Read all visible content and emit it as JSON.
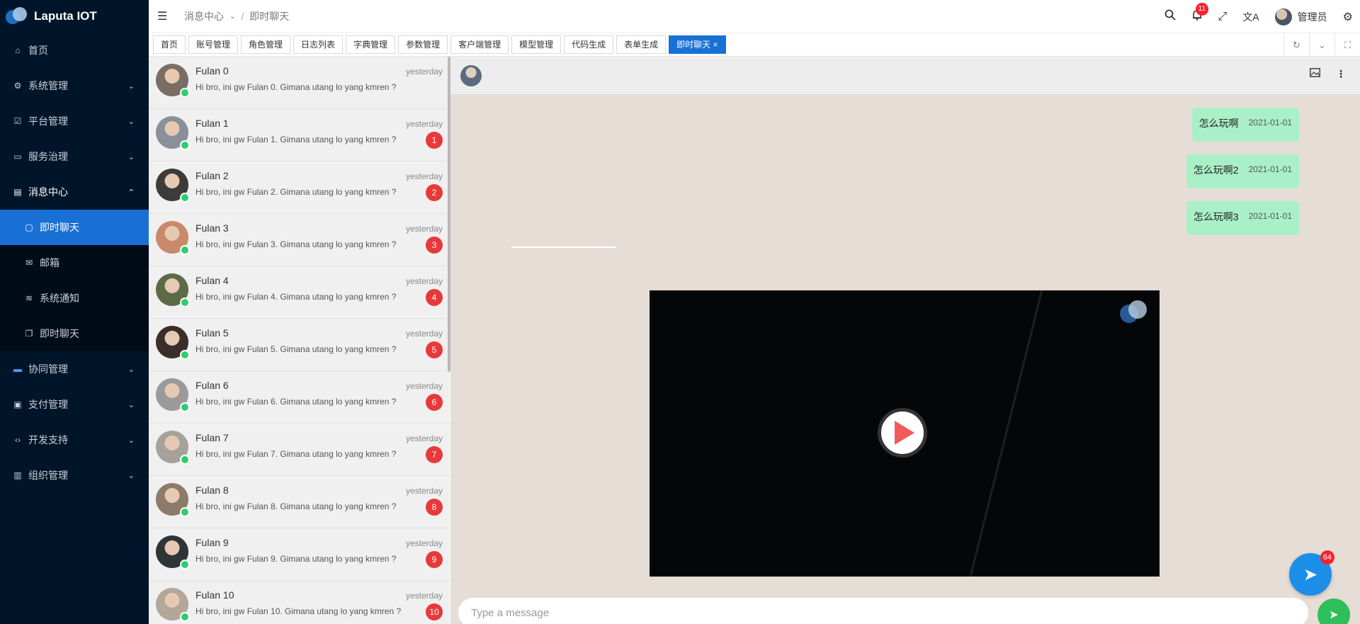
{
  "app": {
    "title": "Laputa IOT"
  },
  "sidebar": {
    "items": [
      {
        "label": "首页",
        "icon": "home-icon"
      },
      {
        "label": "系统管理",
        "icon": "gear-icon"
      },
      {
        "label": "平台管理",
        "icon": "check-square-icon"
      },
      {
        "label": "服务治理",
        "icon": "monitor-icon"
      },
      {
        "label": "消息中心",
        "icon": "message-icon"
      },
      {
        "label": "协同管理",
        "icon": "card-icon"
      },
      {
        "label": "支付管理",
        "icon": "payment-icon"
      },
      {
        "label": "开发支持",
        "icon": "code-icon"
      },
      {
        "label": "组织管理",
        "icon": "building-icon"
      }
    ],
    "submenu": [
      {
        "label": "即时聊天",
        "icon": "chat-icon"
      },
      {
        "label": "邮箱",
        "icon": "mail-icon"
      },
      {
        "label": "系统通知",
        "icon": "notification-icon"
      },
      {
        "label": "即时聊天",
        "icon": "chat-copy-icon"
      }
    ]
  },
  "header": {
    "breadcrumb": [
      "消息中心",
      "即时聊天"
    ],
    "notification_count": "11",
    "user_name": "管理员"
  },
  "tabs": [
    {
      "label": "首页"
    },
    {
      "label": "账号管理"
    },
    {
      "label": "角色管理"
    },
    {
      "label": "日志列表"
    },
    {
      "label": "字典管理"
    },
    {
      "label": "参数管理"
    },
    {
      "label": "客户端管理"
    },
    {
      "label": "模型管理"
    },
    {
      "label": "代码生成"
    },
    {
      "label": "表单生成"
    },
    {
      "label": "即时聊天 ×"
    }
  ],
  "chats": [
    {
      "name": "Fulan 0",
      "time": "yesterday",
      "msg": "Hi bro, ini gw Fulan 0. Gimana utang lo yang kmren ?",
      "count": ""
    },
    {
      "name": "Fulan 1",
      "time": "yesterday",
      "msg": "Hi bro, ini gw Fulan 1. Gimana utang lo yang kmren ?",
      "count": "1"
    },
    {
      "name": "Fulan 2",
      "time": "yesterday",
      "msg": "Hi bro, ini gw Fulan 2. Gimana utang lo yang kmren ?",
      "count": "2"
    },
    {
      "name": "Fulan 3",
      "time": "yesterday",
      "msg": "Hi bro, ini gw Fulan 3. Gimana utang lo yang kmren ?",
      "count": "3"
    },
    {
      "name": "Fulan 4",
      "time": "yesterday",
      "msg": "Hi bro, ini gw Fulan 4. Gimana utang lo yang kmren ?",
      "count": "4"
    },
    {
      "name": "Fulan 5",
      "time": "yesterday",
      "msg": "Hi bro, ini gw Fulan 5. Gimana utang lo yang kmren ?",
      "count": "5"
    },
    {
      "name": "Fulan 6",
      "time": "yesterday",
      "msg": "Hi bro, ini gw Fulan 6. Gimana utang lo yang kmren ?",
      "count": "6"
    },
    {
      "name": "Fulan 7",
      "time": "yesterday",
      "msg": "Hi bro, ini gw Fulan 7. Gimana utang lo yang kmren ?",
      "count": "7"
    },
    {
      "name": "Fulan 8",
      "time": "yesterday",
      "msg": "Hi bro, ini gw Fulan 8. Gimana utang lo yang kmren ?",
      "count": "8"
    },
    {
      "name": "Fulan 9",
      "time": "yesterday",
      "msg": "Hi bro, ini gw Fulan 9. Gimana utang lo yang kmren ?",
      "count": "9"
    },
    {
      "name": "Fulan 10",
      "time": "yesterday",
      "msg": "Hi bro, ini gw Fulan 10. Gimana utang lo yang kmren ?",
      "count": "10"
    }
  ],
  "messages": [
    {
      "text": "怎么玩啊",
      "time": "2021-01-01"
    },
    {
      "text": "怎么玩啊2",
      "time": "2021-01-01"
    },
    {
      "text": "怎么玩啊3",
      "time": "2021-01-01"
    }
  ],
  "fab": {
    "count": "64"
  },
  "composer": {
    "placeholder": "Type a message"
  },
  "colors": {
    "sidebar": "#001529",
    "accent": "#1870d5",
    "bubble": "#a9f0c8",
    "badge": "#e8393a",
    "send": "#2fbf5a"
  }
}
